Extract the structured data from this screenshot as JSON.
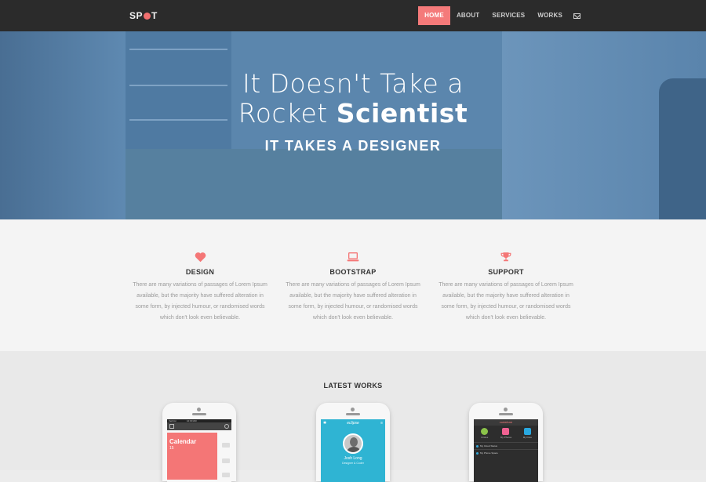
{
  "brand": {
    "logo_left": "SP",
    "logo_right": "T"
  },
  "nav": {
    "items": [
      "HOME",
      "ABOUT",
      "SERVICES",
      "WORKS"
    ],
    "active": "HOME"
  },
  "hero": {
    "line1": "It Doesn't Take a",
    "line2_plain": "Rocket ",
    "line2_bold": "Scientist",
    "subtitle": "IT TAKES A DESIGNER"
  },
  "features": [
    {
      "icon": "heart-icon",
      "title": "DESIGN",
      "text": "There are many variations of passages of Lorem Ipsum available, but the majority have suffered alteration in some form, by injected humour, or randomised words which don't look even believable."
    },
    {
      "icon": "laptop-icon",
      "title": "BOOTSTRAP",
      "text": "There are many variations of passages of Lorem Ipsum available, but the majority have suffered alteration in some form, by injected humour, or randomised words which don't look even believable."
    },
    {
      "icon": "trophy-icon",
      "title": "SUPPORT",
      "text": "There are many variations of passages of Lorem Ipsum available, but the majority have suffered alteration in some form, by injected humour, or randomised words which don't look even believable."
    }
  ],
  "works": {
    "title": "LATEST WORKS",
    "phone1": {
      "status": "Verizon",
      "time": "12:00 AM",
      "card_title": "Calendar",
      "card_sub": "15"
    },
    "phone2": {
      "app": "eclipse",
      "name": "Josh Long",
      "role": "Designer & Coder"
    },
    "phone3": {
      "brand": "vodafone",
      "icons": [
        "Circles",
        "My Photos",
        "My Files"
      ],
      "rows": [
        "My Cloud Status",
        "My Phone Space"
      ]
    }
  },
  "colors": {
    "accent": "#f47a7a",
    "nav_bg": "#2b2b2b",
    "hero_tint": "#5b86ad"
  }
}
